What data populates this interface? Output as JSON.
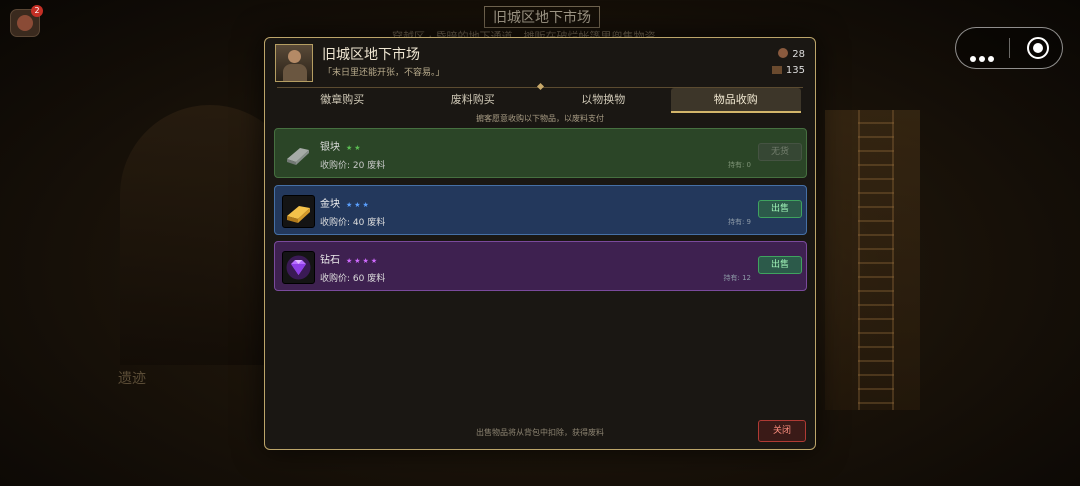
{
  "scene": {
    "title": "旧城区地下市场",
    "subtitle": "穿越区 · 昏暗的地下通道，摊贩在破烂帐篷里兜售物资",
    "corridor_text": "遗迹",
    "avatar_badge": "2"
  },
  "modal": {
    "title": "旧城区地下市场",
    "quote": "「末日里还能开张，不容易。」",
    "resources": {
      "coins": "28",
      "scrap": "135"
    },
    "tabs": [
      {
        "label": "徽章购买"
      },
      {
        "label": "废料购买"
      },
      {
        "label": "以物换物"
      },
      {
        "label": "物品收购"
      }
    ],
    "active_tab": "物品收购",
    "hint": "掮客愿意收购以下物品，以废料支付",
    "items": [
      {
        "name": "银块",
        "stars": "★★",
        "price": "收购价: 20 废料",
        "owned": "持有: 0",
        "button": "无货",
        "enabled": false
      },
      {
        "name": "金块",
        "stars": "★★★",
        "price": "收购价: 40 废料",
        "owned": "持有: 9",
        "button": "出售",
        "enabled": true
      },
      {
        "name": "钻石",
        "stars": "★★★★",
        "price": "收购价: 60 废料",
        "owned": "持有: 12",
        "button": "出售",
        "enabled": true
      }
    ],
    "footer": "出售物品将从背包中扣除，获得废料",
    "close_label": "关闭"
  }
}
